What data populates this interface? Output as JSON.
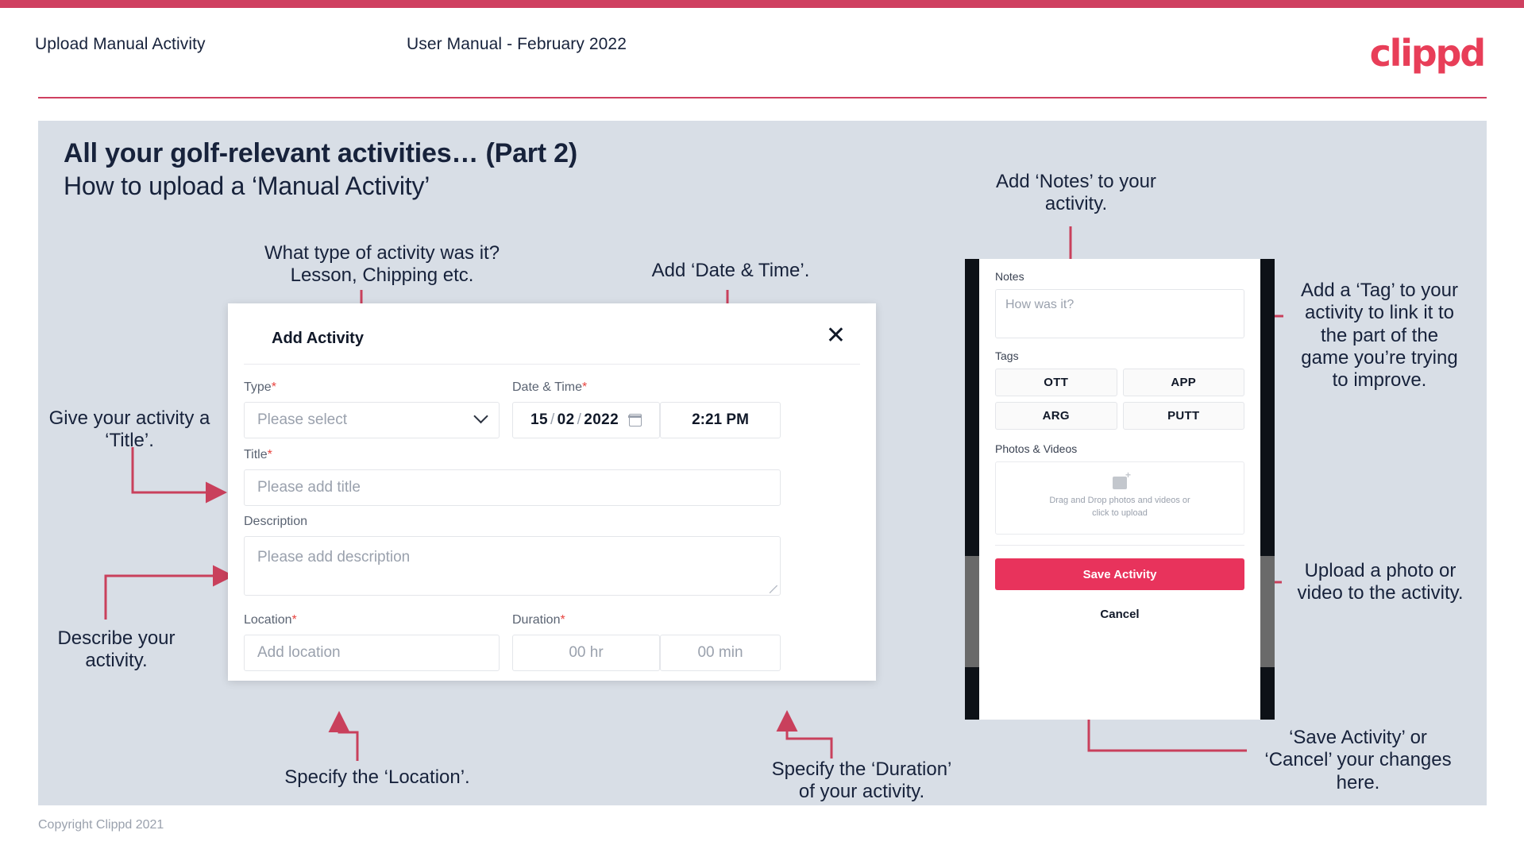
{
  "header": {
    "title": "Upload Manual Activity",
    "subtitle": "User Manual - February 2022",
    "logo": "clippd"
  },
  "slide": {
    "heading": "All your golf-relevant activities… (Part 2)",
    "subheading": "How to upload a ‘Manual Activity’"
  },
  "dialog": {
    "title": "Add Activity",
    "close_icon": "close-icon",
    "fields": {
      "type": {
        "label": "Type",
        "required": "*",
        "placeholder": "Please select"
      },
      "datetime": {
        "label": "Date & Time",
        "required": "*",
        "day": "15",
        "month": "02",
        "year": "2022",
        "time": "2:21 PM"
      },
      "title": {
        "label": "Title",
        "required": "*",
        "placeholder": "Please add title"
      },
      "description": {
        "label": "Description",
        "required": "",
        "placeholder": "Please add description"
      },
      "location": {
        "label": "Location",
        "required": "*",
        "placeholder": "Add location"
      },
      "duration": {
        "label": "Duration",
        "required": "*",
        "hours": "00 hr",
        "minutes": "00 min"
      }
    }
  },
  "phone": {
    "notes": {
      "label": "Notes",
      "placeholder": "How was it?"
    },
    "tags": {
      "label": "Tags",
      "items": [
        "OTT",
        "APP",
        "ARG",
        "PUTT"
      ]
    },
    "photos": {
      "label": "Photos & Videos",
      "dropzone_line1": "Drag and Drop photos and videos or",
      "dropzone_line2": "click to upload",
      "icon": "image-add-icon"
    },
    "save_label": "Save Activity",
    "cancel_label": "Cancel"
  },
  "annotations": {
    "type": "What type of activity was it?\nLesson, Chipping etc.",
    "datetime": "Add ‘Date & Time’.",
    "title": "Give your activity a\n‘Title’.",
    "description": "Describe your\nactivity.",
    "location": "Specify the ‘Location’.",
    "duration": "Specify the ‘Duration’\nof your activity.",
    "notes": "Add ‘Notes’ to your\nactivity.",
    "tags": "Add a ‘Tag’ to your\nactivity to link it to\nthe part of the\ngame you’re trying\nto improve.",
    "photos": "Upload a photo or\nvideo to the activity.",
    "save": "‘Save Activity’ or\n‘Cancel’ your changes\nhere."
  },
  "footer": {
    "copyright": "Copyright Clippd 2021"
  },
  "colors": {
    "brand": "#e8335c",
    "accent_rule": "#cf4060",
    "slide_bg": "#d8dee6",
    "text_dark": "#17223b",
    "annotation_line": "#c9405c"
  }
}
